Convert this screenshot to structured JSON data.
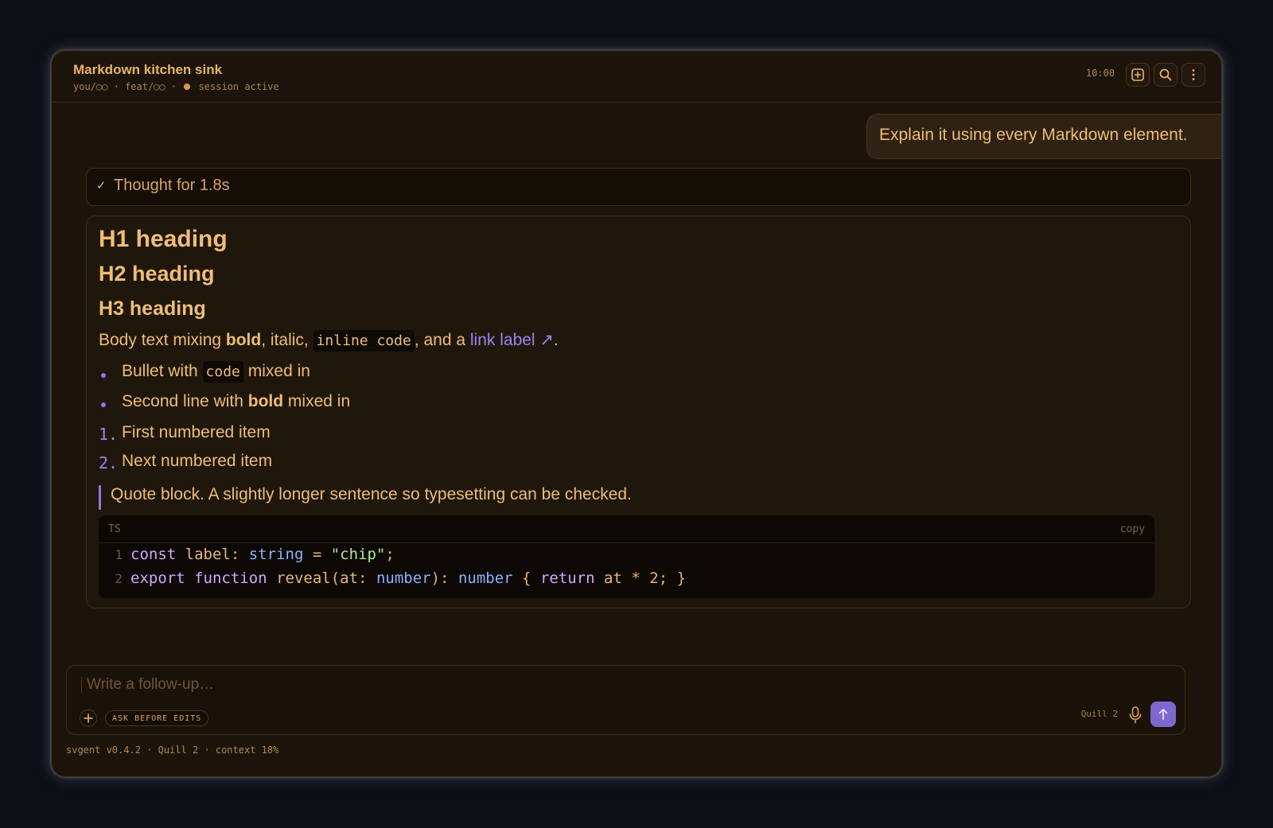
{
  "window": {
    "title": "Markdown kitchen sink",
    "path_user": "you/◯◯",
    "separator": "·",
    "path_branch": "feat/◯◯",
    "session_status": "session active",
    "clock": "10:00"
  },
  "toolbar": {
    "new_icon": "plus-square-icon",
    "search_icon": "search-icon",
    "menu_icon": "more-vertical-icon"
  },
  "conversation": {
    "user_message": "Explain it using every Markdown element.",
    "thought": {
      "check": "✓",
      "label": "Thought for 1.8s"
    },
    "answer": {
      "h1": "H1 heading",
      "h2": "H2 heading",
      "h3": "H3 heading",
      "body": {
        "prefix": "Body text mixing ",
        "bold": "bold",
        "mid": ", italic, ",
        "code": "inline code",
        "mid2": ", and a ",
        "link": "link label ↗",
        "suffix": "."
      },
      "bullets": [
        {
          "pre": "Bullet with ",
          "code": "code",
          "post": " mixed in"
        },
        {
          "pre": "Second line with ",
          "bold": "bold",
          "post": " mixed in"
        }
      ],
      "numbered": [
        {
          "num": "1.",
          "text": "First numbered item"
        },
        {
          "num": "2.",
          "text": "Next numbered item"
        }
      ],
      "quote": "Quote block. A slightly longer sentence so typesetting can be checked.",
      "code_block": {
        "lang": "TS",
        "copy_label": "copy",
        "lines": [
          {
            "n": "1",
            "text": "const label: string = \"chip\";"
          },
          {
            "n": "2",
            "text": "export function reveal(at: number): number { return at * 2; }"
          }
        ]
      }
    }
  },
  "composer": {
    "placeholder": "Write a follow-up…",
    "value": "",
    "mode_chip": "ASK BEFORE EDITS",
    "model": "Quill 2",
    "accent": "#7d68cf"
  },
  "status_bar": "svgent v0.4.2 · Quill 2 · context 18%"
}
